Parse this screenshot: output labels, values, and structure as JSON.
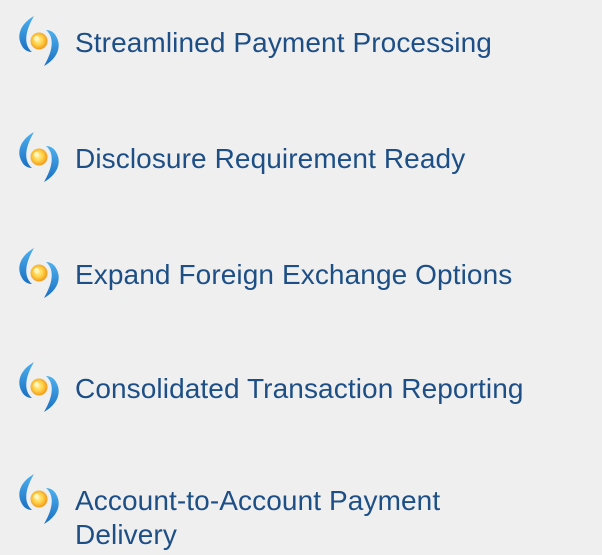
{
  "features": {
    "items": [
      {
        "label": "Streamlined Payment Processing",
        "icon": "orbit-bullet-icon"
      },
      {
        "label": "Disclosure Requirement Ready",
        "icon": "orbit-bullet-icon"
      },
      {
        "label": "Expand Foreign Exchange Options",
        "icon": "orbit-bullet-icon"
      },
      {
        "label": "Consolidated Transaction Reporting",
        "icon": "orbit-bullet-icon"
      },
      {
        "label": "Account-to-Account Payment Delivery",
        "icon": "orbit-bullet-icon"
      }
    ]
  },
  "colors": {
    "background": "#efefef",
    "text": "#1d4f86",
    "swoosh_blue": "#2b8ad6",
    "dot_orange": "#f5a21a",
    "dot_yellow": "#ffe066"
  }
}
